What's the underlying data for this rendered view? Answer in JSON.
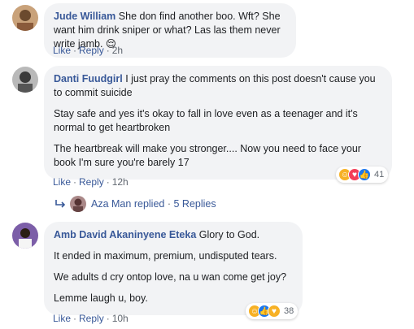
{
  "comments": [
    {
      "author": "Jude William",
      "paragraphs": [
        "She don find another boo. Wft? She want him drink sniper or what? Las las them never write jamb. 😌"
      ],
      "like": "Like",
      "reply": "Reply",
      "time": "2h"
    },
    {
      "author": "Danti Fuudgirl",
      "paragraphs": [
        "I just pray the comments on this post doesn't cause you to commit suicide",
        "Stay safe and yes it's okay to fall in love even as a teenager and it's normal to get heartbroken",
        "The heartbreak will make you stronger.... Now you need to face your book I'm sure you're barely 17"
      ],
      "like": "Like",
      "reply": "Reply",
      "time": "12h",
      "reactions": {
        "icons": [
          "haha-icon",
          "love-icon",
          "like-icon"
        ],
        "count": "41"
      },
      "replies": {
        "name": "Aza Man",
        "replied": "replied",
        "count_label": "5 Replies"
      }
    },
    {
      "author": "Amb David Akaninyene Eteka",
      "paragraphs": [
        "Glory to God.",
        "It ended in maximum, premium, undisputed tears.",
        "We adults d cry ontop love, na u wan come get joy?",
        "Lemme laugh u, boy."
      ],
      "like": "Like",
      "reply": "Reply",
      "time": "10h",
      "reactions": {
        "icons": [
          "haha-icon",
          "like-icon",
          "care-icon"
        ],
        "count": "38"
      }
    }
  ],
  "separator": "·",
  "colors": {
    "link": "#385898",
    "bubble": "#f2f3f5",
    "meta": "#606770"
  }
}
